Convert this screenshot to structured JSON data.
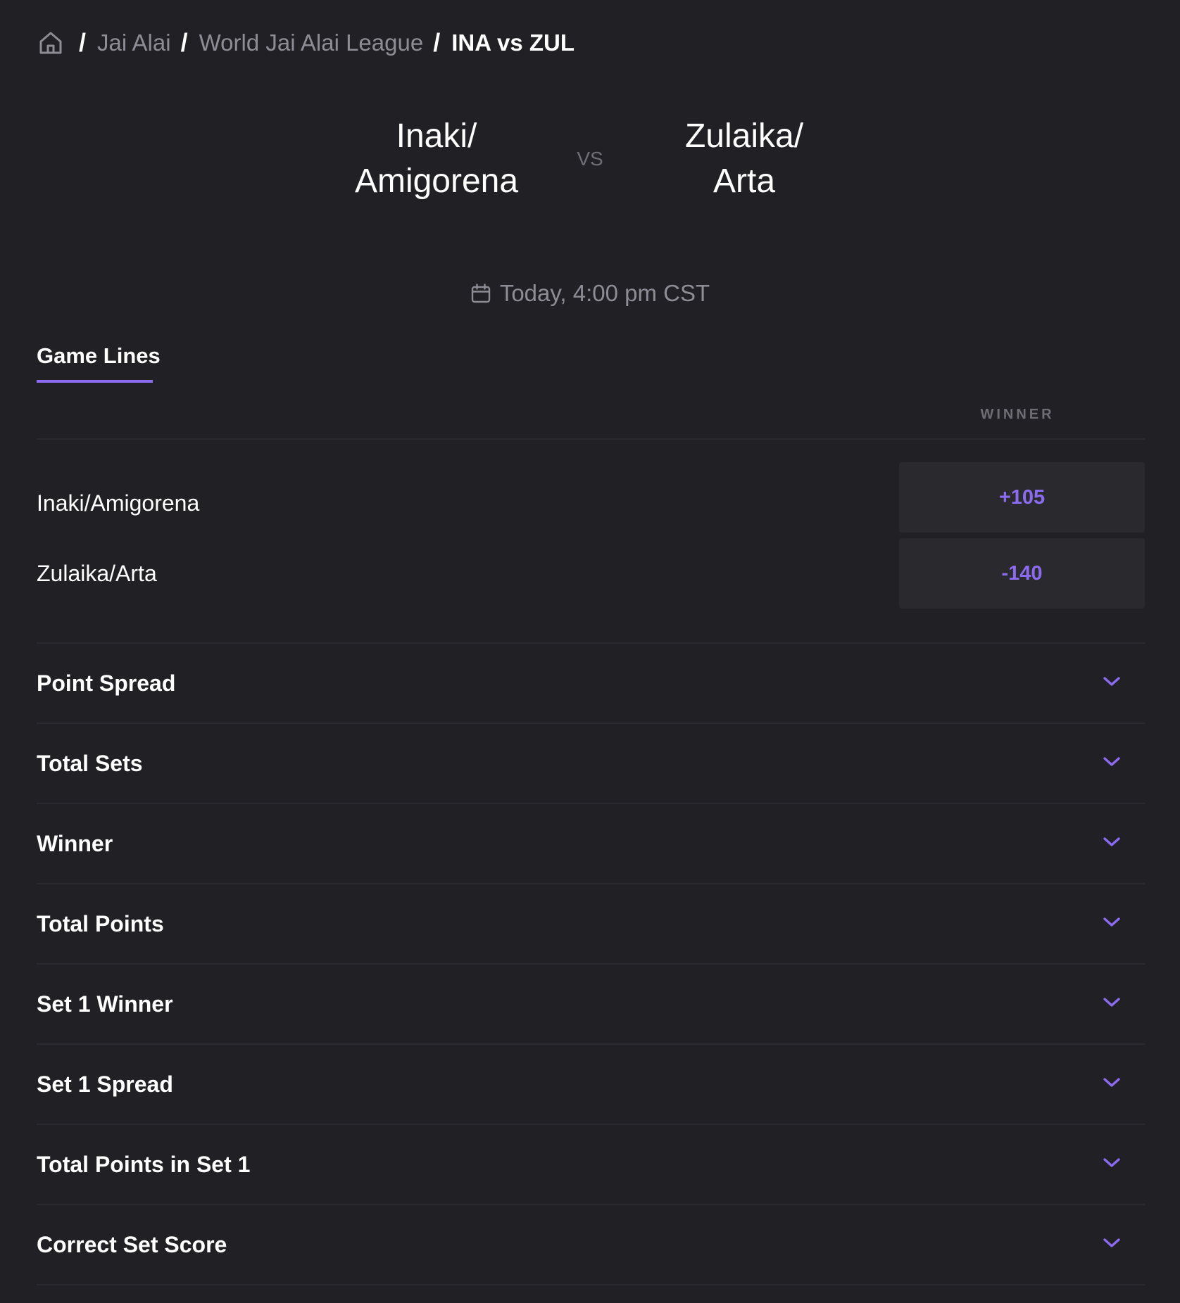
{
  "breadcrumb": {
    "home_icon": "home-icon",
    "items": [
      "Jai Alai",
      "World Jai Alai League"
    ],
    "current": "INA vs ZUL",
    "separator": "/"
  },
  "matchup": {
    "team_left_line1": "Inaki/",
    "team_left_line2": "Amigorena",
    "vs": "VS",
    "team_right_line1": "Zulaika/",
    "team_right_line2": "Arta",
    "schedule_icon": "calendar-icon",
    "schedule": "Today, 4:00 pm CST"
  },
  "tabs": [
    {
      "label": "Game Lines",
      "active": true
    }
  ],
  "game_lines": {
    "column_header": "WINNER",
    "rows": [
      {
        "team": "Inaki/Amigorena",
        "odds": "+105"
      },
      {
        "team": "Zulaika/Arta",
        "odds": "-140"
      }
    ]
  },
  "markets": [
    {
      "label": "Point Spread",
      "icon": "chevron-down-icon"
    },
    {
      "label": "Total Sets",
      "icon": "chevron-down-icon"
    },
    {
      "label": "Winner",
      "icon": "chevron-down-icon"
    },
    {
      "label": "Total Points",
      "icon": "chevron-down-icon"
    },
    {
      "label": "Set 1 Winner",
      "icon": "chevron-down-icon"
    },
    {
      "label": "Set 1 Spread",
      "icon": "chevron-down-icon"
    },
    {
      "label": "Total Points in Set 1",
      "icon": "chevron-down-icon"
    },
    {
      "label": "Correct Set Score",
      "icon": "chevron-down-icon"
    }
  ],
  "colors": {
    "background": "#212024",
    "accent": "#8b6cf0",
    "muted_text": "#8e8c95",
    "odds_button_bg": "#2a292e",
    "divider": "#2b2a30"
  }
}
